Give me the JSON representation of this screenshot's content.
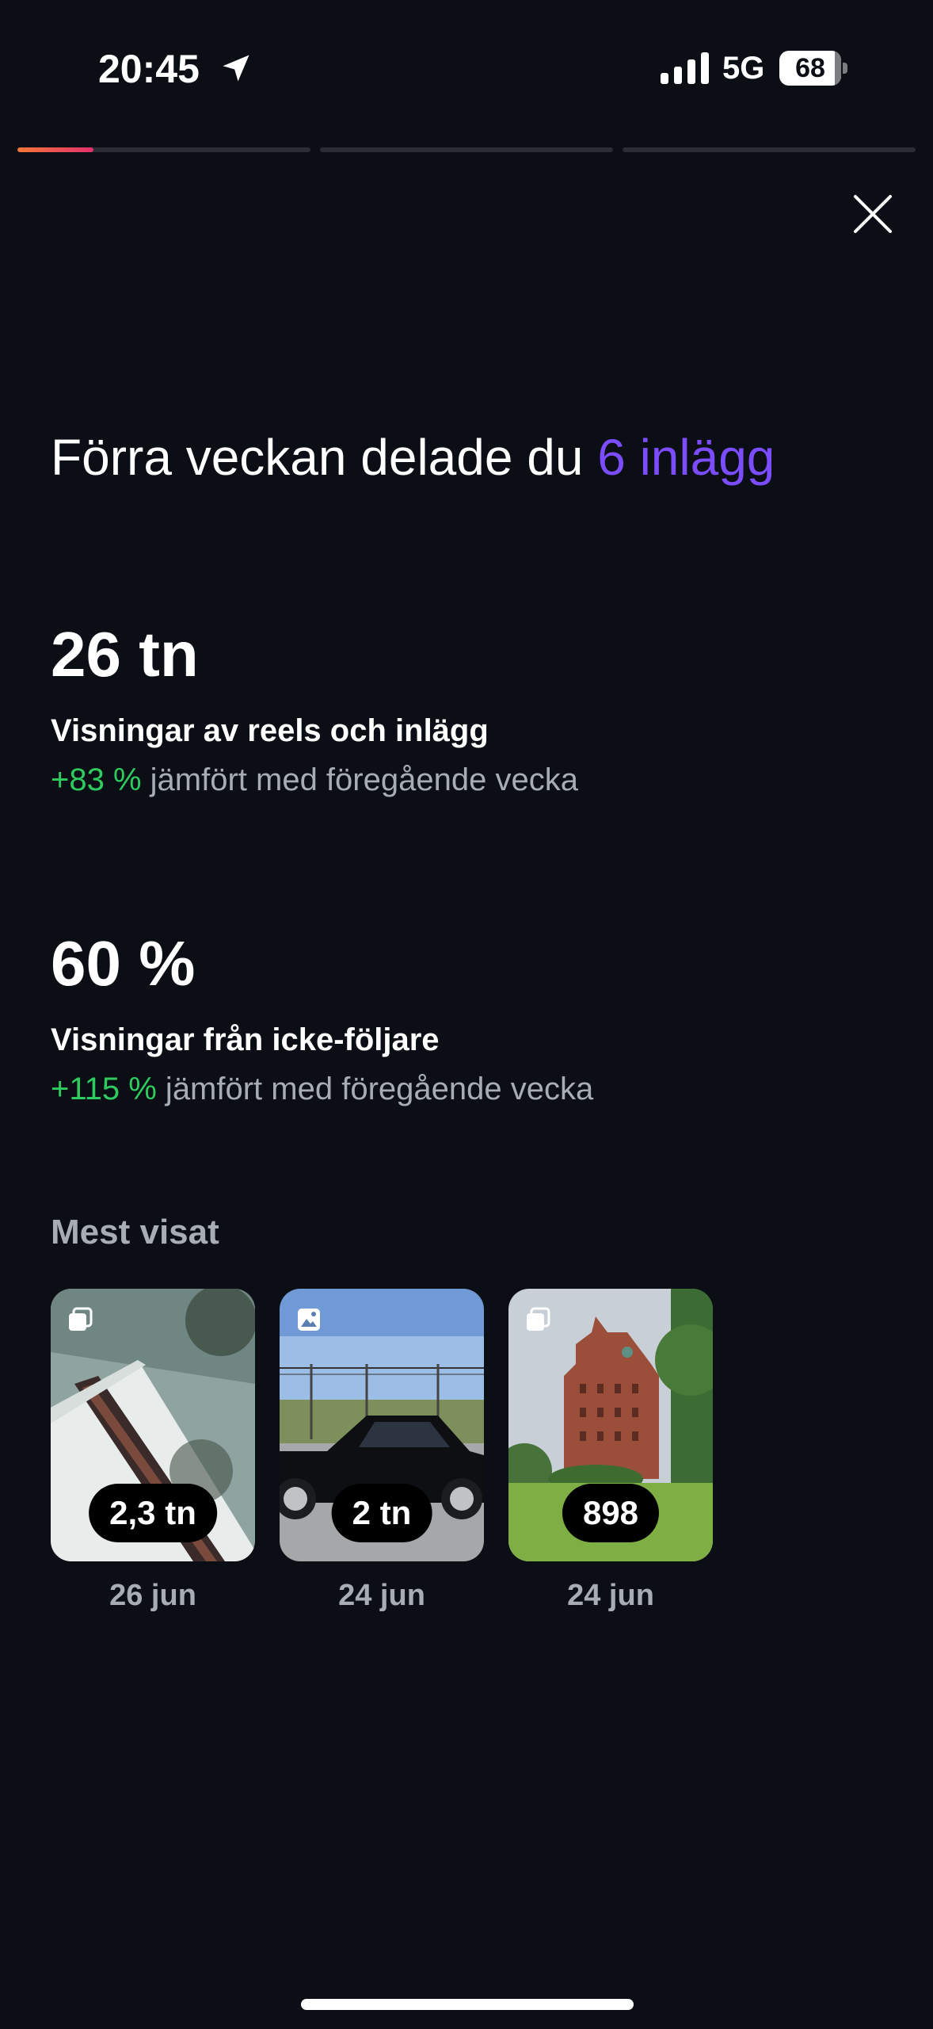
{
  "status_bar": {
    "time": "20:45",
    "network": "5G",
    "battery": "68",
    "icons": [
      "location-arrow-icon",
      "cellular-signal-icon",
      "battery-icon"
    ]
  },
  "story_progress": {
    "segments": 3,
    "active_segment": 1,
    "active_fraction": 0.26,
    "fill_colors": [
      "#f77737",
      "#e1306c"
    ]
  },
  "close_icon": "close-icon",
  "headline": {
    "text": "Förra veckan delade du ",
    "accent": "6 inlägg",
    "accent_color": "#7c4dff"
  },
  "stats": [
    {
      "value": "26 tn",
      "label": "Visningar av reels och inlägg",
      "delta": "+83 %",
      "comparison": " jämfört med föregående vecka"
    },
    {
      "value": "60 %",
      "label": "Visningar från icke-följare",
      "delta": "+115 %",
      "comparison": " jämfört med föregående vecka"
    }
  ],
  "delta_color": "#2ecc5f",
  "most_viewed": {
    "title": "Mest visat",
    "items": [
      {
        "views": "2,3 tn",
        "date": "26 jun",
        "type_icon": "carousel-icon"
      },
      {
        "views": "2 tn",
        "date": "24 jun",
        "type_icon": "photo-icon"
      },
      {
        "views": "898",
        "date": "24 jun",
        "type_icon": "carousel-icon"
      }
    ]
  }
}
